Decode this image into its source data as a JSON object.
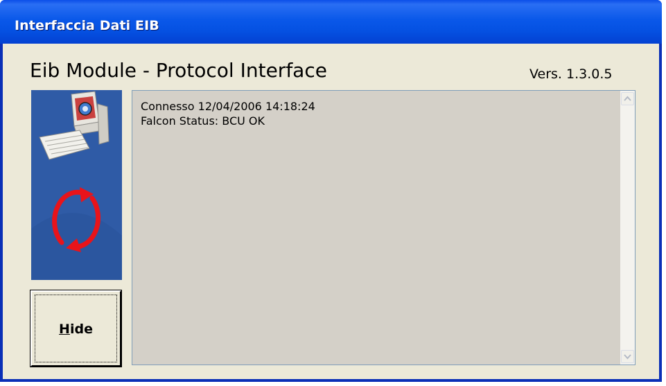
{
  "window": {
    "title": "Interfaccia Dati EIB"
  },
  "header": {
    "app_title": "Eib Module - Protocol Interface",
    "version": "Vers. 1.3.0.5"
  },
  "logo": {
    "icons": [
      "computer-icon",
      "refresh-arrows-icon"
    ]
  },
  "buttons": {
    "hide": {
      "mnemonic": "H",
      "rest": "ide"
    }
  },
  "log": {
    "lines": [
      "Connesso 12/04/2006 14:18:24",
      "Falcon Status: BCU OK"
    ]
  },
  "colors": {
    "titlebar": "#0551e2",
    "client_bg": "#ece9d8",
    "log_bg": "#d4d0c8",
    "logo_panel": "#2f5ba6",
    "sync_arrows": "#e8141b"
  }
}
